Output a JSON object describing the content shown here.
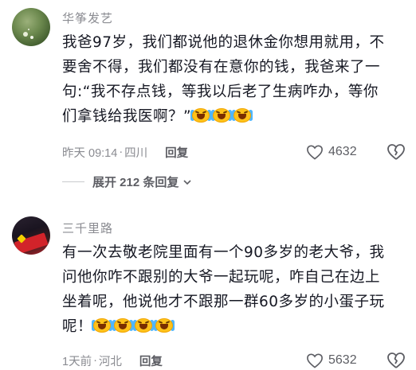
{
  "comments": [
    {
      "username": "华筝发艺",
      "lines": [
        "我爸97岁，我们都说他的退休金你想用就用，不",
        "要舍不得，我们都没有在意你的钱，我爸来了一",
        "句:“我不存点钱，等我以后老了生病咋办，等你",
        "们拿钱给我医啊？”"
      ],
      "emoji_count": 3,
      "emoji_icon": "crying-laughing-emoji",
      "time": "昨天 09:14",
      "separator": "·",
      "location": "四川",
      "reply_label": "回复",
      "likes": "4632",
      "like_icon": "heart-outline-icon",
      "dislike_icon": "broken-heart-icon",
      "expand_label": "展开 212 条回复",
      "expand_icon": "chevron-down-icon"
    },
    {
      "username": "三千里路",
      "lines": [
        "有一次去敬老院里面有一个90多岁的老大爷，我",
        "问他你咋不跟别的大爷一起玩呢，咋自己在边上",
        "坐着呢，他说他才不跟那一群60多岁的小蛋子玩",
        "呢！"
      ],
      "emoji_count": 4,
      "emoji_icon": "crying-laughing-emoji",
      "time": "1天前",
      "separator": "·",
      "location": "河北",
      "reply_label": "回复",
      "likes": "5632",
      "like_icon": "heart-outline-icon",
      "dislike_icon": "broken-heart-icon"
    }
  ],
  "colors": {
    "text": "#161823",
    "meta": "#8a8b91",
    "emoji": "#ffc21a"
  }
}
